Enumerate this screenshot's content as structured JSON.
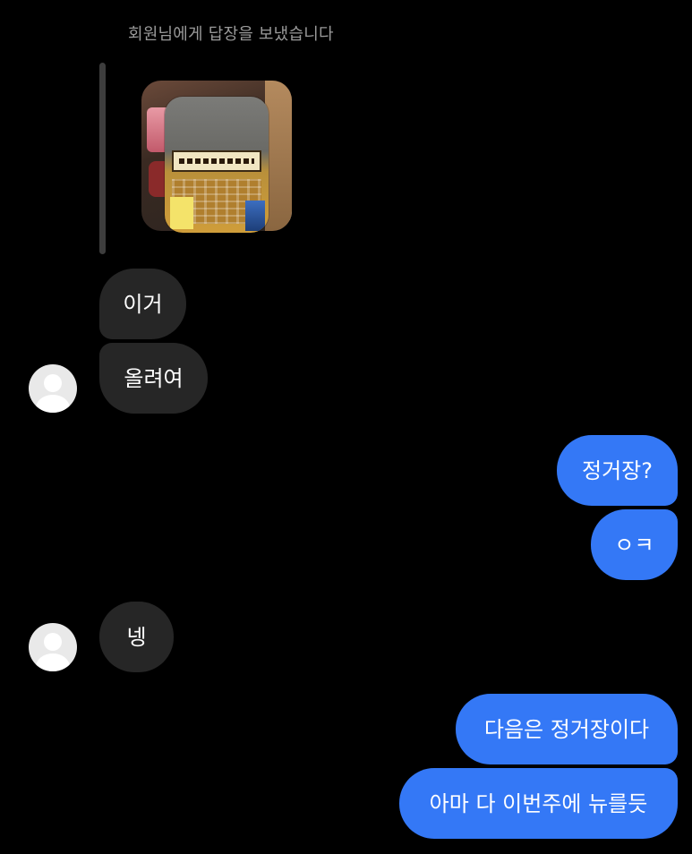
{
  "reply_caption": "회원님에게 답장을 보냈습니다",
  "colors": {
    "background": "#000000",
    "incoming_bubble": "#262626",
    "outgoing_bubble": "#3478f6",
    "caption": "#9a9a9a"
  },
  "messages": [
    {
      "sender": "them",
      "text": "이거"
    },
    {
      "sender": "them",
      "text": "올려여"
    },
    {
      "sender": "me",
      "text": "정거장?"
    },
    {
      "sender": "me",
      "text": "ㅇㅋ"
    },
    {
      "sender": "them",
      "text": "넹"
    },
    {
      "sender": "me",
      "text": "다음은 정거장이다"
    },
    {
      "sender": "me",
      "text": "아마 다 이번주에 뉴를듯"
    }
  ],
  "icons": {
    "avatar": "default-avatar-icon"
  }
}
